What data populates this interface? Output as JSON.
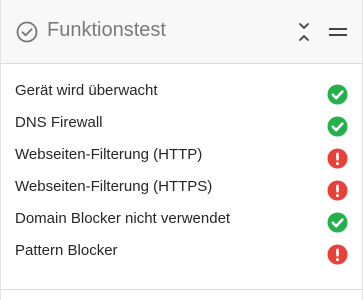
{
  "widget": {
    "title": "Funktionstest",
    "header_icon": "circle-check-outline-icon",
    "collapse_icon": "collapse-chevrons-icon",
    "menu_icon": "hamburger-icon"
  },
  "status_colors": {
    "ok": "#22b14c",
    "error": "#e8413a"
  },
  "checks": [
    {
      "label": "Gerät wird überwacht",
      "status": "ok"
    },
    {
      "label": "DNS Firewall",
      "status": "ok"
    },
    {
      "label": "Webseiten-Filterung (HTTP)",
      "status": "error"
    },
    {
      "label": "Webseiten-Filterung (HTTPS)",
      "status": "error"
    },
    {
      "label": "Domain Blocker nicht verwendet",
      "status": "ok"
    },
    {
      "label": "Pattern Blocker",
      "status": "error"
    }
  ]
}
